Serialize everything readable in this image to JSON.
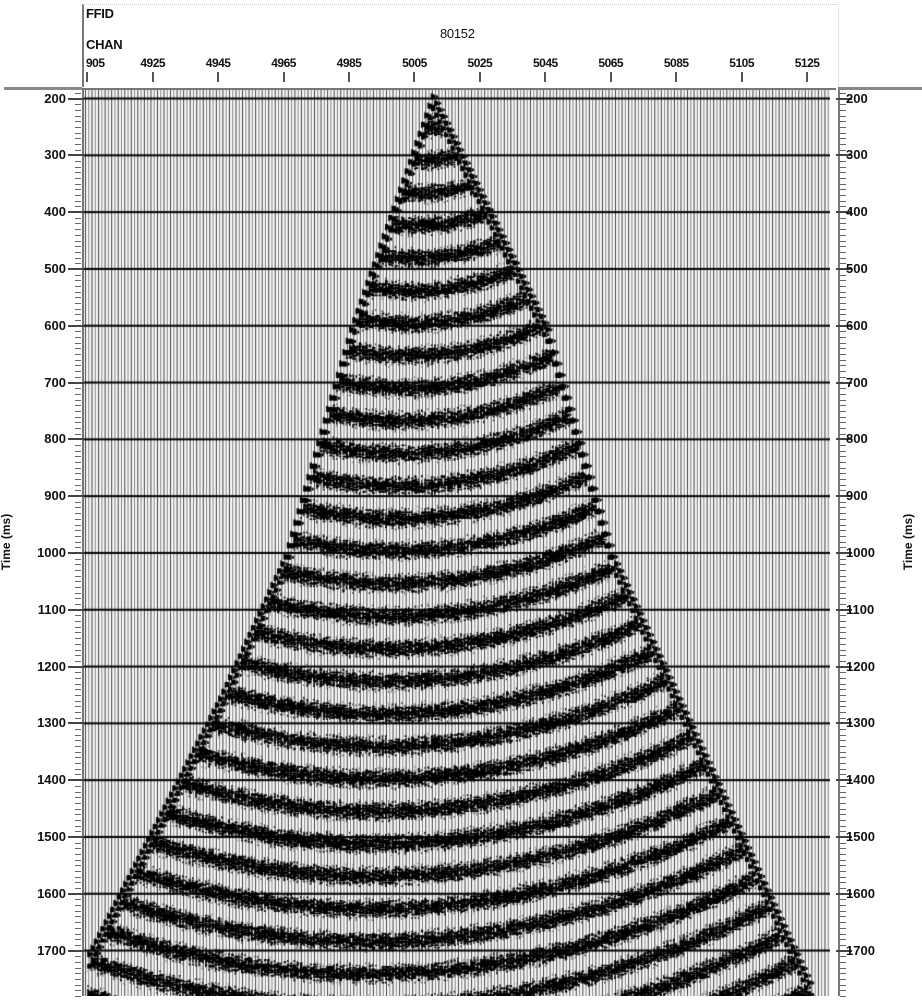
{
  "chart_data": {
    "type": "seismic-wiggle-gather",
    "title": "80152",
    "header_fields": [
      {
        "name": "FFID",
        "value": "80152"
      },
      {
        "name": "CHAN",
        "value": ""
      }
    ],
    "x_axis": {
      "label": "CHAN",
      "tick_labels": [
        "905",
        "4925",
        "4945",
        "4965",
        "4985",
        "5005",
        "5025",
        "5045",
        "5065",
        "5085",
        "5105",
        "5125"
      ],
      "tick_values": [
        4905,
        4925,
        4945,
        4965,
        4985,
        5005,
        5025,
        5045,
        5065,
        5085,
        5105,
        5125
      ],
      "range": [
        4904,
        5132
      ]
    },
    "y_axis": {
      "label": "Time (ms)",
      "tick_labels": [
        "200",
        "300",
        "400",
        "500",
        "600",
        "700",
        "800",
        "900",
        "1000",
        "1100",
        "1200",
        "1300",
        "1400",
        "1500",
        "1600",
        "1700"
      ],
      "tick_values": [
        200,
        300,
        400,
        500,
        600,
        700,
        800,
        900,
        1000,
        1100,
        1200,
        1300,
        1400,
        1500,
        1600,
        1700
      ],
      "range": [
        185,
        1780
      ],
      "minor_tick_interval": 10,
      "inverted": true,
      "grid": true,
      "dual_sided": true
    },
    "first_break": {
      "apex_channel": 5010,
      "apex_time_ms": 190,
      "left_edge": [
        [
          4905,
          1700
        ],
        [
          4945,
          1250
        ],
        [
          4965,
          1000
        ],
        [
          4985,
          600
        ],
        [
          5010,
          190
        ]
      ],
      "right_edge": [
        [
          5010,
          190
        ],
        [
          5045,
          600
        ],
        [
          5065,
          1000
        ],
        [
          5085,
          1250
        ],
        [
          5125,
          1750
        ]
      ]
    },
    "display": {
      "trace_style": "variable area wiggle",
      "trace_color": "#000000",
      "background": "#ffffff"
    }
  },
  "axis_titles": {
    "left": "Time (ms)",
    "right": "Time (ms)"
  }
}
